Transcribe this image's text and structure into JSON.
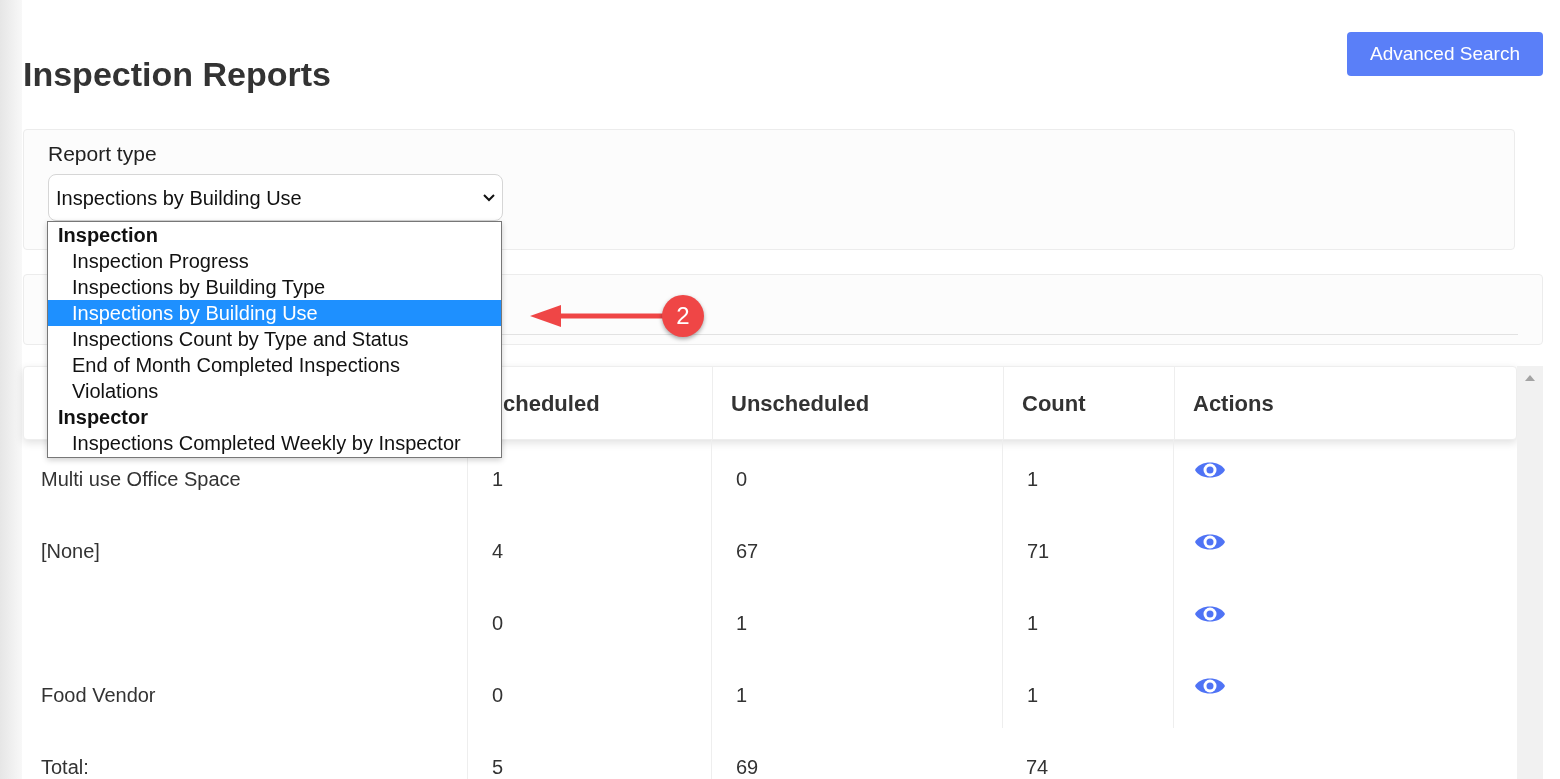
{
  "page": {
    "title": "Inspection Reports",
    "advanced_search": "Advanced Search"
  },
  "report_type": {
    "label": "Report type",
    "value": "Inspections by Building Use",
    "expanded": true,
    "options": [
      {
        "kind": "group",
        "label": "Inspection",
        "selected": false
      },
      {
        "kind": "option",
        "label": "Inspection Progress",
        "selected": false
      },
      {
        "kind": "option",
        "label": "Inspections by Building Type",
        "selected": false
      },
      {
        "kind": "option",
        "label": "Inspections by Building Use",
        "selected": true
      },
      {
        "kind": "option",
        "label": "Inspections Count by Type and Status",
        "selected": false
      },
      {
        "kind": "option",
        "label": "End of Month Completed Inspections",
        "selected": false
      },
      {
        "kind": "option",
        "label": "Violations",
        "selected": false
      },
      {
        "kind": "group",
        "label": "Inspector",
        "selected": false
      },
      {
        "kind": "option",
        "label": "Inspections Completed Weekly by Inspector",
        "selected": false
      }
    ]
  },
  "annotation": {
    "badge": "2"
  },
  "table": {
    "columns": [
      "",
      "cheduled",
      "Unscheduled",
      "Count",
      "Actions"
    ],
    "rows": [
      {
        "cells": [
          "Multi use Office Space",
          "1",
          "0",
          "1"
        ]
      },
      {
        "cells": [
          "[None]",
          "4",
          "67",
          "71"
        ]
      },
      {
        "cells": [
          "",
          "0",
          "1",
          "1"
        ]
      },
      {
        "cells": [
          "Food Vendor",
          "0",
          "1",
          "1"
        ]
      }
    ],
    "total": [
      "Total:",
      "5",
      "69",
      "74"
    ]
  }
}
